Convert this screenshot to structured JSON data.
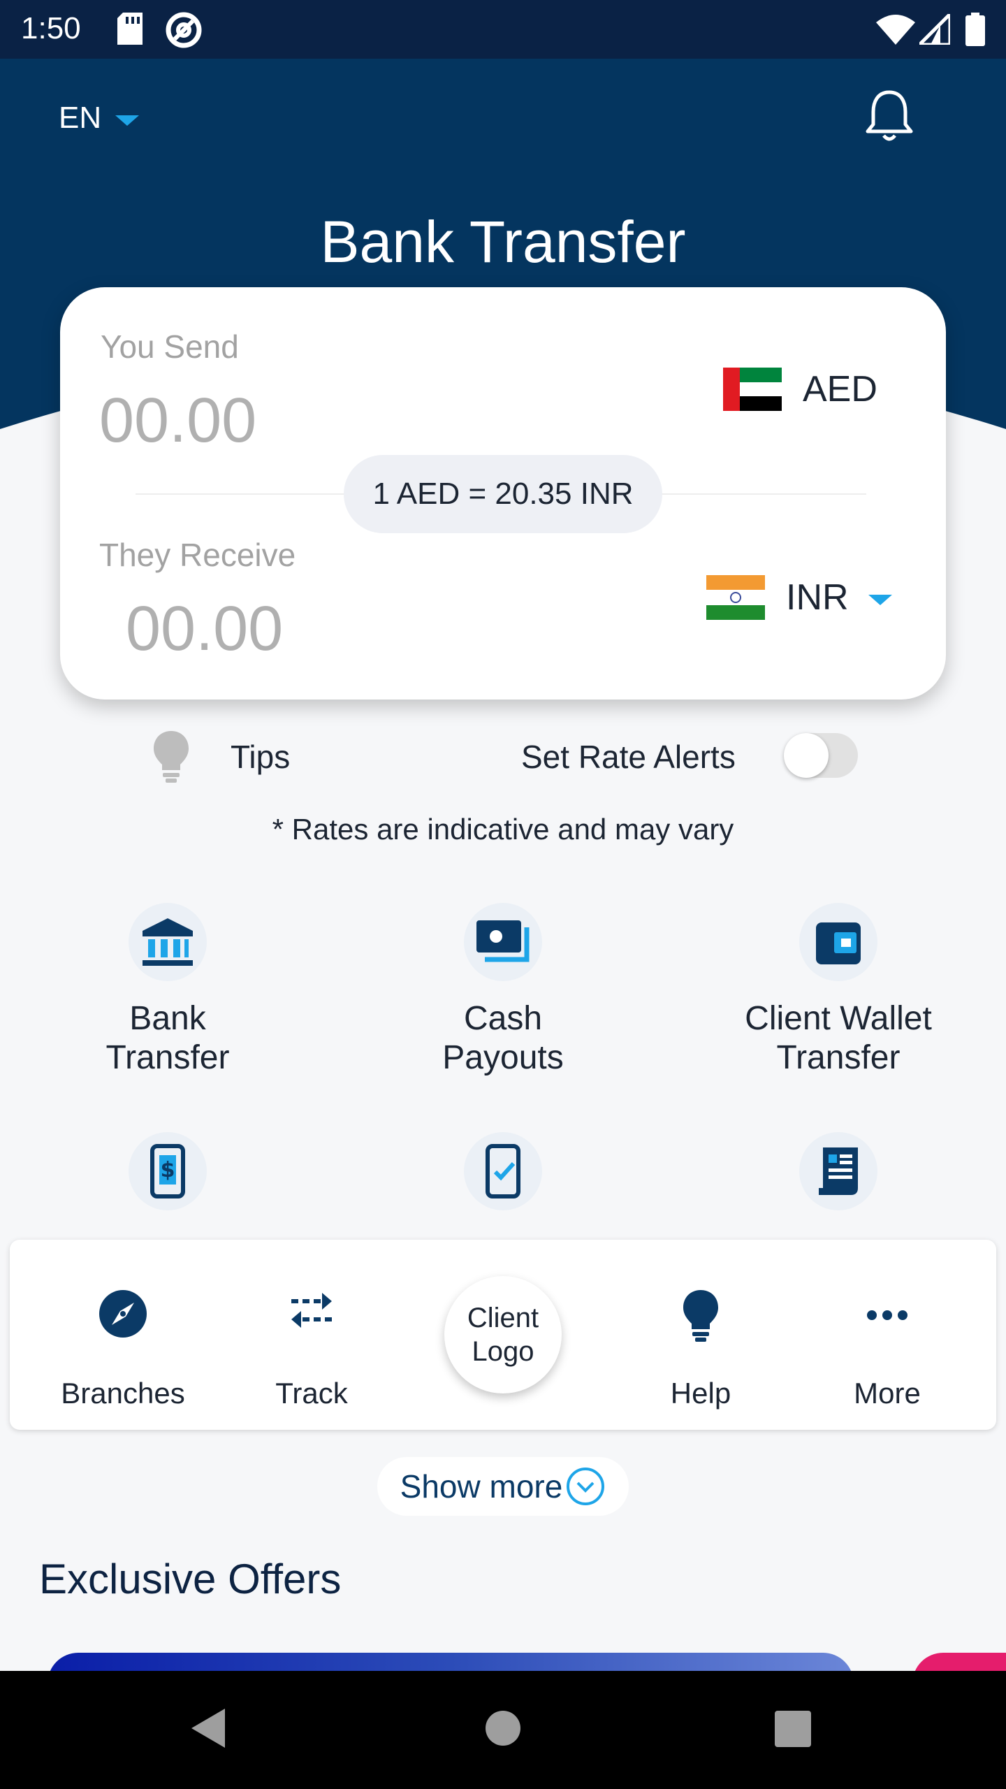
{
  "status_bar": {
    "time": "1:50"
  },
  "header": {
    "language": "EN",
    "title": "Bank Transfer",
    "bg_color": "#04355f",
    "icons": [
      "chevron-down-icon",
      "bell-icon"
    ]
  },
  "converter": {
    "send_label": "You Send",
    "send_amount": "00.00",
    "send_currency": "AED",
    "rate_text": "1 AED = 20.35 INR",
    "receive_label": "They Receive",
    "receive_amount": "00.00",
    "receive_currency": "INR"
  },
  "options": {
    "tips_label": "Tips",
    "rate_alert_label": "Set Rate Alerts",
    "rate_alert_enabled": false,
    "disclaimer": "* Rates are indicative and may vary"
  },
  "services": [
    {
      "label_line1": "Bank",
      "label_line2": "Transfer",
      "icon": "bank-icon"
    },
    {
      "label_line1": "Cash",
      "label_line2": "Payouts",
      "icon": "cash-icon"
    },
    {
      "label_line1": "Client Wallet",
      "label_line2": "Transfer",
      "icon": "wallet-icon"
    },
    {
      "icon": "mobile-dollar-icon"
    },
    {
      "icon": "mobile-check-icon"
    },
    {
      "icon": "bill-icon"
    }
  ],
  "tabbar": {
    "branches": "Branches",
    "track": "Track",
    "client_logo_line1": "Client",
    "client_logo_line2": "Logo",
    "help": "Help",
    "more": "More"
  },
  "show_more": "Show more",
  "offers": {
    "title": "Exclusive Offers"
  },
  "colors": {
    "accent": "#1ea5e8",
    "primary": "#04355f",
    "offer_pink": "#e51d6c"
  }
}
